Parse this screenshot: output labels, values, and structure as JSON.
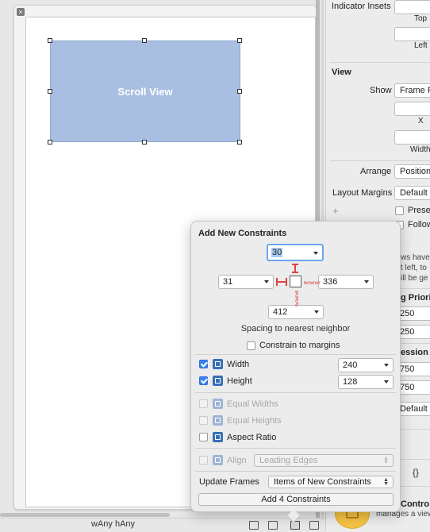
{
  "canvas": {
    "close_glyph": "×",
    "scroll_view_label": "Scroll View",
    "size_class_text": "wAny hAny"
  },
  "inspector": {
    "indicator_insets_label": "Indicator Insets",
    "top_label": "Top",
    "left_label": "Left",
    "view_section": "View",
    "show_label": "Show",
    "show_value": "Frame Rectangle",
    "x_label": "X",
    "width_label": "Width",
    "arrange_label": "Arrange",
    "arrange_value": "Position View",
    "layout_margins_label": "Layout Margins",
    "layout_margins_value": "Default",
    "plus_glyph": "+",
    "preserve_label": "Preserve Superview Margins",
    "follow_label": "Follow Readable Width",
    "desc_lines": [
      "ws have",
      "t left, to",
      "ill be ge"
    ],
    "hugging_header": "g Priority",
    "hugging_values": [
      "250",
      "250"
    ],
    "compression_header": "ession R",
    "compression_values": [
      "750",
      "750"
    ],
    "default_label": "Default",
    "braces": "{}",
    "controller_title": "Contro",
    "controller_desc": "manages a view"
  },
  "popover": {
    "title": "Add New Constraints",
    "top_value": "30",
    "left_value": "31",
    "right_value": "336",
    "bottom_value": "412",
    "spacing_caption": "Spacing to nearest neighbor",
    "constrain_margins_label": "Constrain to margins",
    "width_label": "Width",
    "width_value": "240",
    "height_label": "Height",
    "height_value": "128",
    "equal_widths_label": "Equal Widths",
    "equal_heights_label": "Equal Heights",
    "aspect_ratio_label": "Aspect Ratio",
    "align_label": "Align",
    "align_value": "Leading Edges",
    "update_frames_label": "Update Frames",
    "update_frames_value": "Items of New Constraints",
    "add_button_label": "Add 4 Constraints"
  }
}
